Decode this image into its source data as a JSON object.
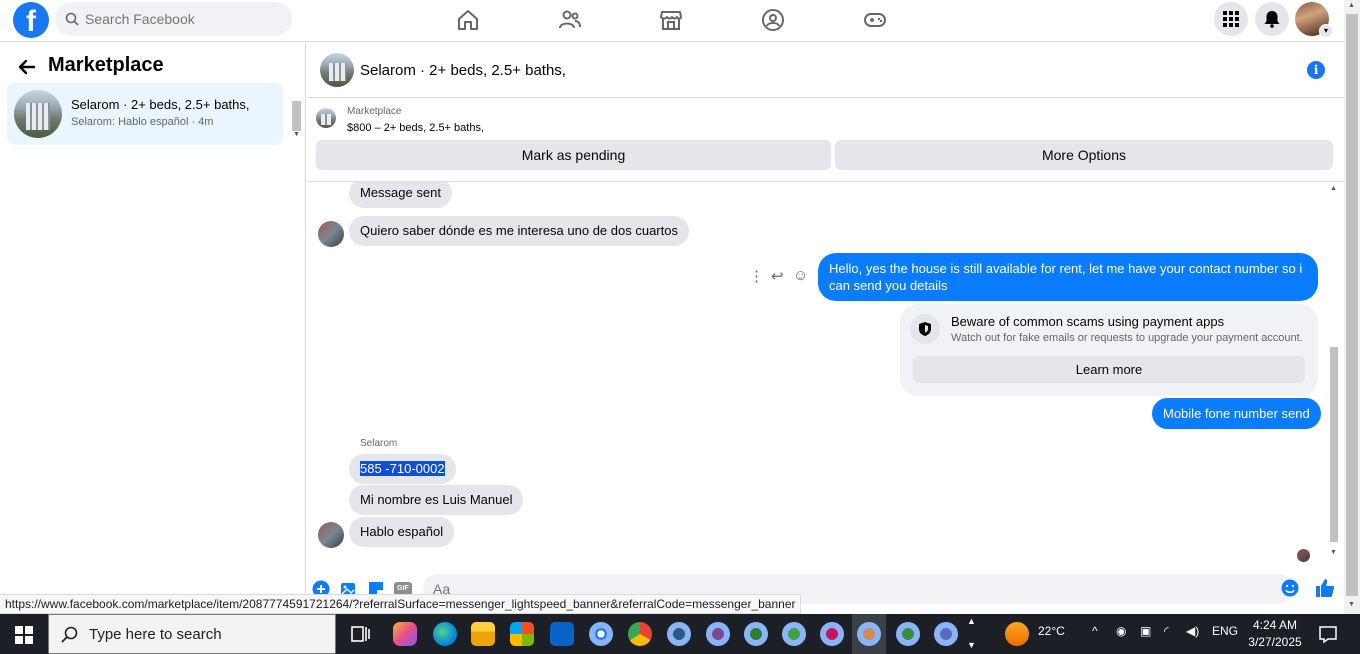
{
  "topbar": {
    "logo": "f",
    "search_placeholder": "Search Facebook"
  },
  "sidebar": {
    "title": "Marketplace",
    "conversation": {
      "name": "Selarom · 2+ beds, 2.5+ baths,",
      "preview": "Selarom: Hablo español · 4m"
    }
  },
  "chat": {
    "title": "Selarom · 2+ beds, 2.5+ baths,",
    "listing": {
      "source": "Marketplace",
      "price_line": "$800 – 2+ beds, 2.5+ baths,",
      "mark_pending": "Mark as pending",
      "more_options": "More Options"
    },
    "messages": {
      "m1": "Message sent",
      "m2": "Quiero saber dónde es me interesa uno de dos cuartos",
      "m3": "Hello, yes the house is still available for rent, let me have your contact number so i can send you details",
      "scam_title": "Beware of common scams using payment apps",
      "scam_sub": "Watch out for fake emails or requests to upgrade your payment account.",
      "learn_more": "Learn more",
      "m4": "Mobile fone number send",
      "sender": "Selarom",
      "m5": "585 -710-0002",
      "m6": "Mi nombre es Luis Manuel",
      "m7": "Hablo español"
    },
    "composer_placeholder": "Aa",
    "gif_label": "GIF"
  },
  "status_url": "https://www.facebook.com/marketplace/item/2087774591721264/?referralSurface=messenger_lightspeed_banner&referralCode=messenger_banner",
  "taskbar": {
    "search_placeholder": "Type here to search",
    "weather": "22°C",
    "lang": "ENG",
    "time": "4:24 AM",
    "date": "3/27/2025"
  },
  "colors": {
    "brand": "#1877f2",
    "outgoing": "#0a7cff",
    "incoming": "#e4e6eb"
  }
}
